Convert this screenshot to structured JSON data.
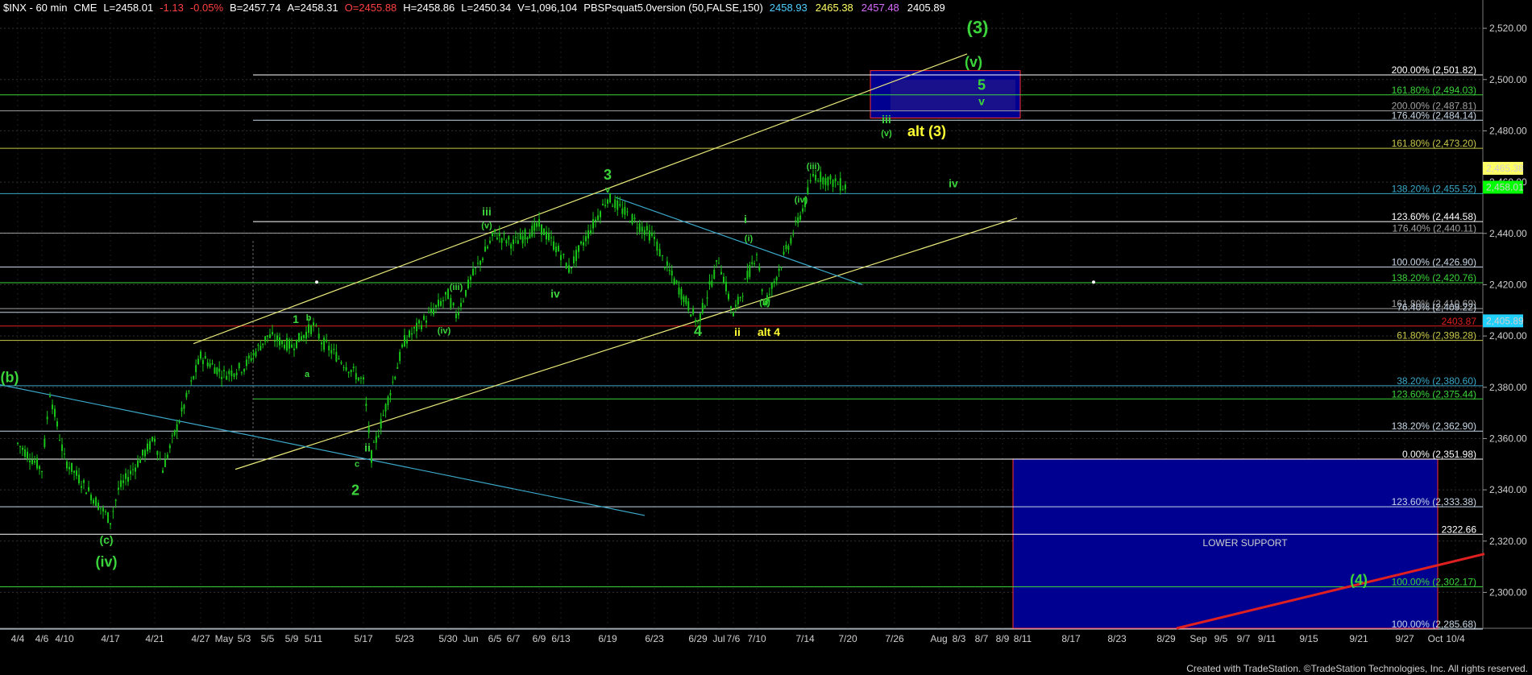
{
  "header": {
    "symbol": "$INX - 60 min",
    "exchange": "CME",
    "last": "L=2458.01",
    "change": "-1.13",
    "change_pct": "-0.05%",
    "bid": "B=2457.74",
    "ask": "A=2458.31",
    "open": "O=2455.88",
    "high": "H=2458.86",
    "low": "L=2450.34",
    "volume": "V=1,096,104",
    "study": "PBSPsquat5.0version (50,FALSE,150)",
    "study_values": [
      "2458.93",
      "2465.38",
      "2457.48",
      "2405.89"
    ],
    "study_colors": [
      "#4fd0ff",
      "#ffff66",
      "#d86cff",
      "#ffffff"
    ]
  },
  "footer_credit": "Created with TradeStation. ©TradeStation Technologies, Inc. All rights reserved.",
  "price_tags": [
    {
      "text": "2,465.38",
      "price": 2465.38,
      "bg": "#ffff66",
      "fg": "#000000"
    },
    {
      "text": "2,458.01",
      "price": 2458.01,
      "bg": "#00ff00",
      "fg": "#000000"
    },
    {
      "text": "2,405.89",
      "price": 2405.89,
      "bg": "#20d0ff",
      "fg": "#000000"
    }
  ],
  "lower_support_label": "LOWER SUPPORT",
  "colors": {
    "candle": "#19c419",
    "grid": "#333333",
    "wave_green": "#3bd43b",
    "wave_yellow": "#ffff33",
    "channel": "#e8e87a",
    "trend_cyan": "#3aa8c8",
    "box_blue": "#000090",
    "red_trend": "#e02020"
  },
  "chart_data": {
    "type": "candlestick",
    "title": "$INX - 60 min",
    "x_tick_labels": [
      "4/4",
      "4/6",
      "4/10",
      "4/17",
      "4/21",
      "4/27",
      "May",
      "5/3",
      "5/5",
      "5/9",
      "5/11",
      "5/17",
      "5/23",
      "5/30",
      "Jun",
      "6/5",
      "6/7",
      "6/9",
      "6/13",
      "6/19",
      "6/23",
      "6/29",
      "Jul",
      "7/6",
      "7/10",
      "7/14",
      "7/20",
      "7/26",
      "Aug",
      "8/3",
      "8/7",
      "8/9",
      "8/11",
      "8/17",
      "8/23",
      "8/29",
      "Sep",
      "9/5",
      "9/7",
      "9/11",
      "9/15",
      "9/21",
      "9/27",
      "Oct",
      "10/4"
    ],
    "y_tick_labels": [
      "2,300.00",
      "2,320.00",
      "2,340.00",
      "2,360.00",
      "2,380.00",
      "2,400.00",
      "2,420.00",
      "2,440.00",
      "2,460.00",
      "2,480.00",
      "2,500.00",
      "2,520.00"
    ],
    "ylim": [
      2286,
      2526
    ],
    "y_grid": [
      2300,
      2320,
      2340,
      2360,
      2380,
      2400,
      2420,
      2440,
      2460,
      2480,
      2500,
      2520
    ],
    "price_path": [
      {
        "date": "4/4",
        "price": 2358
      },
      {
        "date": "4/6",
        "price": 2348
      },
      {
        "date": "4/6",
        "price": 2378
      },
      {
        "date": "4/10",
        "price": 2352
      },
      {
        "date": "4/17",
        "price": 2328
      },
      {
        "date": "4/17",
        "price": 2340
      },
      {
        "date": "4/21",
        "price": 2360
      },
      {
        "date": "4/21",
        "price": 2348
      },
      {
        "date": "4/27",
        "price": 2392
      },
      {
        "date": "May",
        "price": 2385
      },
      {
        "date": "5/3",
        "price": 2388
      },
      {
        "date": "5/5",
        "price": 2400
      },
      {
        "date": "5/9",
        "price": 2396
      },
      {
        "date": "5/11",
        "price": 2404
      },
      {
        "date": "5/11",
        "price": 2398
      },
      {
        "date": "5/17",
        "price": 2382
      },
      {
        "date": "5/17",
        "price": 2353
      },
      {
        "date": "5/23",
        "price": 2398
      },
      {
        "date": "5/30",
        "price": 2416
      },
      {
        "date": "5/30",
        "price": 2408
      },
      {
        "date": "Jun",
        "price": 2422
      },
      {
        "date": "6/5",
        "price": 2440
      },
      {
        "date": "6/7",
        "price": 2436
      },
      {
        "date": "6/9",
        "price": 2443
      },
      {
        "date": "6/13",
        "price": 2432
      },
      {
        "date": "6/13",
        "price": 2426
      },
      {
        "date": "6/19",
        "price": 2454
      },
      {
        "date": "6/23",
        "price": 2438
      },
      {
        "date": "6/23",
        "price": 2430
      },
      {
        "date": "6/29",
        "price": 2405
      },
      {
        "date": "Jul",
        "price": 2430
      },
      {
        "date": "7/6",
        "price": 2408
      },
      {
        "date": "7/10",
        "price": 2433
      },
      {
        "date": "7/10",
        "price": 2412
      },
      {
        "date": "7/14",
        "price": 2452
      },
      {
        "date": "7/14",
        "price": 2463
      },
      {
        "date": "7/20",
        "price": 2458
      }
    ],
    "fib_levels": [
      {
        "text": "200.00% (2,501.82)",
        "price": 2501.82,
        "color": "#ffffff"
      },
      {
        "text": "161.80% (2,494.03)",
        "price": 2494.03,
        "color": "#3bd43b"
      },
      {
        "text": "200.00% (2,487.81)",
        "price": 2487.81,
        "color": "#a0a0a0"
      },
      {
        "text": "176.40% (2,484.14)",
        "price": 2484.14,
        "color": "#c8d8e8"
      },
      {
        "text": "161.80% (2,473.20)",
        "price": 2473.2,
        "color": "#c8c84a"
      },
      {
        "text": "138.20% (2,455.52)",
        "price": 2455.52,
        "color": "#3aa8c8"
      },
      {
        "text": "123.60% (2,444.58)",
        "price": 2444.58,
        "color": "#ffffff"
      },
      {
        "text": "176.40% (2,440.11)",
        "price": 2440.11,
        "color": "#a0a0a0"
      },
      {
        "text": "100.00% (2,426.90)",
        "price": 2426.9,
        "color": "#c8d8e8"
      },
      {
        "text": "138.20% (2,420.76)",
        "price": 2420.76,
        "color": "#3bd43b"
      },
      {
        "text": "161.80% (2,410.69)",
        "price": 2410.69,
        "color": "#a0a0a0"
      },
      {
        "text": "76.40% (2,409.22)",
        "price": 2409.22,
        "color": "#c8d8e8"
      },
      {
        "text": "2403.87",
        "price": 2403.87,
        "color": "#e02020"
      },
      {
        "text": "61.80% (2,398.28)",
        "price": 2398.28,
        "color": "#c8c84a"
      },
      {
        "text": "38.20% (2,380.60)",
        "price": 2380.6,
        "color": "#3aa8c8"
      },
      {
        "text": "123.60% (2,375.44)",
        "price": 2375.44,
        "color": "#3bd43b"
      },
      {
        "text": "138.20% (2,362.90)",
        "price": 2362.9,
        "color": "#c8d8e8"
      },
      {
        "text": "0.00% (2,351.98)",
        "price": 2351.98,
        "color": "#ffffff"
      },
      {
        "text": "123.60% (2,333.38)",
        "price": 2333.38,
        "color": "#c8d8e8"
      },
      {
        "text": "2322.66",
        "price": 2322.66,
        "color": "#ffffff"
      },
      {
        "text": "100.00% (2,302.17)",
        "price": 2302.17,
        "color": "#3bd43b"
      },
      {
        "text": "100.00% (2,285.68)",
        "price": 2285.68,
        "color": "#c8d8e8"
      }
    ],
    "wave_labels": [
      {
        "text": "(b)",
        "date": "4/4",
        "price": 2382,
        "color": "green",
        "size": "l"
      },
      {
        "text": "(c)",
        "date": "4/17",
        "price": 2319,
        "color": "green",
        "size": "m"
      },
      {
        "text": "(iv)",
        "date": "4/17",
        "price": 2310,
        "color": "green",
        "size": "l"
      },
      {
        "text": "1",
        "date": "5/9",
        "price": 2405,
        "color": "green",
        "size": "m"
      },
      {
        "text": "a",
        "date": "5/11",
        "price": 2384,
        "color": "green",
        "size": "s"
      },
      {
        "text": "b",
        "date": "5/11",
        "price": 2406,
        "color": "green",
        "size": "s"
      },
      {
        "text": "ii",
        "date": "5/17",
        "price": 2355,
        "color": "green",
        "size": "m"
      },
      {
        "text": "c",
        "date": "5/17",
        "price": 2349,
        "color": "green",
        "size": "s"
      },
      {
        "text": "2",
        "date": "5/17",
        "price": 2338,
        "color": "green",
        "size": "l"
      },
      {
        "text": "(iii)",
        "date": "5/30",
        "price": 2418,
        "color": "green",
        "size": "s"
      },
      {
        "text": "(iv)",
        "date": "5/30",
        "price": 2401,
        "color": "green",
        "size": "s"
      },
      {
        "text": "iii",
        "date": "6/5",
        "price": 2447,
        "color": "green",
        "size": "m"
      },
      {
        "text": "(v)",
        "date": "6/5",
        "price": 2442,
        "color": "green",
        "size": "s"
      },
      {
        "text": "3",
        "date": "6/19",
        "price": 2461,
        "color": "green",
        "size": "l"
      },
      {
        "text": "v",
        "date": "6/19",
        "price": 2456,
        "color": "green",
        "size": "s"
      },
      {
        "text": "iv",
        "date": "6/13",
        "price": 2415,
        "color": "green",
        "size": "m"
      },
      {
        "text": "4",
        "date": "6/29",
        "price": 2400,
        "color": "green",
        "size": "l"
      },
      {
        "text": "i",
        "date": "7/6",
        "price": 2444,
        "color": "green",
        "size": "m"
      },
      {
        "text": "(i)",
        "date": "7/10",
        "price": 2437,
        "color": "green",
        "size": "s"
      },
      {
        "text": "(ii)",
        "date": "7/10",
        "price": 2412,
        "color": "green",
        "size": "s"
      },
      {
        "text": "ii",
        "date": "7/6",
        "price": 2400,
        "color": "yellow",
        "size": "m"
      },
      {
        "text": "alt 4",
        "date": "7/10",
        "price": 2400,
        "color": "yellow",
        "size": "m"
      },
      {
        "text": "(iii)",
        "date": "7/14",
        "price": 2465,
        "color": "green",
        "size": "s"
      },
      {
        "text": "(iv)",
        "date": "7/14",
        "price": 2452,
        "color": "green",
        "size": "s"
      },
      {
        "text": "iv",
        "date": "8/3",
        "price": 2458,
        "color": "green",
        "size": "m"
      },
      {
        "text": "iii",
        "date": "7/26",
        "price": 2483,
        "color": "green",
        "size": "m"
      },
      {
        "text": "(v)",
        "date": "7/26",
        "price": 2478,
        "color": "green",
        "size": "s"
      },
      {
        "text": "alt (3)",
        "date": "7/26",
        "price": 2478,
        "color": "yellow",
        "size": "l"
      },
      {
        "text": "(3)",
        "date": "8/7",
        "price": 2518,
        "color": "green",
        "size": "xl"
      },
      {
        "text": "(v)",
        "date": "8/7",
        "price": 2505,
        "color": "green",
        "size": "l"
      },
      {
        "text": "5",
        "date": "8/7",
        "price": 2496,
        "color": "green",
        "size": "l"
      },
      {
        "text": "v",
        "date": "8/7",
        "price": 2490,
        "color": "green",
        "size": "m"
      },
      {
        "text": "(4)",
        "date": "9/21",
        "price": 2303,
        "color": "green",
        "size": "l"
      }
    ]
  }
}
